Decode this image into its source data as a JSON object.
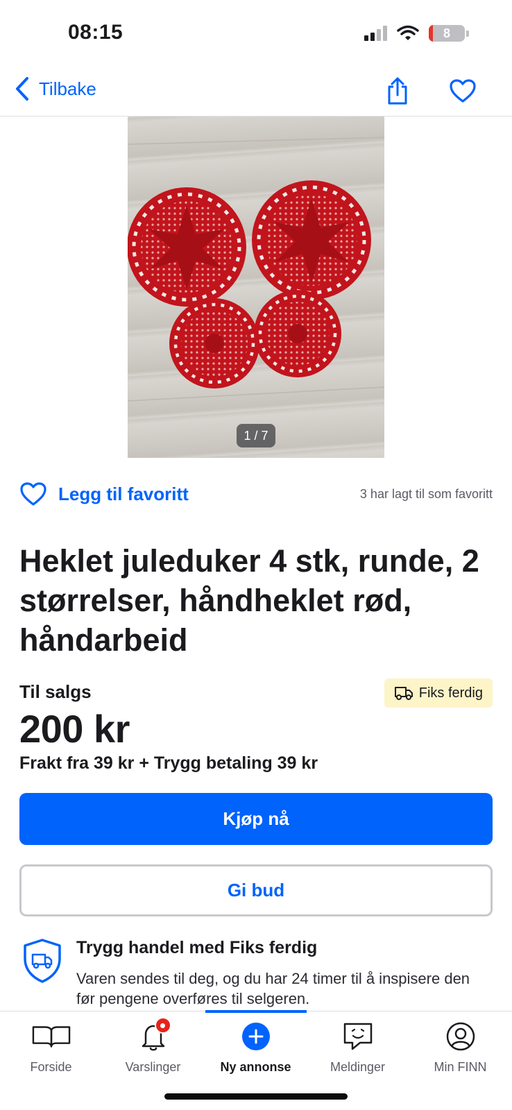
{
  "status_bar": {
    "time": "08:15",
    "battery": "8"
  },
  "nav": {
    "back_label": "Tilbake"
  },
  "gallery": {
    "pager": "1 / 7"
  },
  "favorite": {
    "label": "Legg til favoritt",
    "count_text": "3 har lagt til som favoritt"
  },
  "listing": {
    "title": "Heklet juleduker 4 stk, runde, 2 størrelser, håndheklet rød, håndarbeid",
    "sale_label": "Til salgs",
    "badge": "Fiks ferdig",
    "price": "200 kr",
    "shipping": "Frakt fra 39 kr + Trygg betaling 39 kr"
  },
  "actions": {
    "buy_label": "Kjøp nå",
    "bid_label": "Gi bud"
  },
  "safe_trade": {
    "title": "Trygg handel med Fiks ferdig",
    "text": "Varen sendes til deg, og du har 24 timer til å inspisere den før pengene overføres til selgeren."
  },
  "tabs": [
    {
      "label": "Forside",
      "icon": "book-icon"
    },
    {
      "label": "Varslinger",
      "icon": "bell-icon"
    },
    {
      "label": "Ny annonse",
      "icon": "plus-circle-icon"
    },
    {
      "label": "Meldinger",
      "icon": "chat-icon"
    },
    {
      "label": "Min FINN",
      "icon": "profile-icon"
    }
  ],
  "colors": {
    "accent": "#0063fb",
    "badge_bg": "#fdf4c8",
    "notification": "#e5231b",
    "doily_red": "#c2141c"
  }
}
